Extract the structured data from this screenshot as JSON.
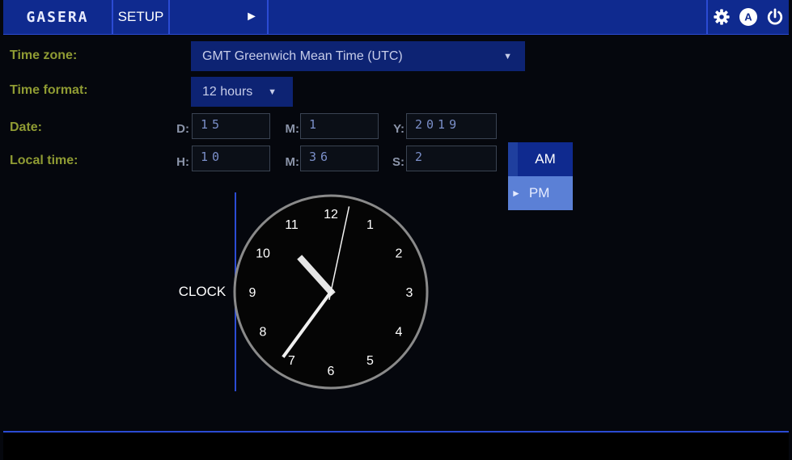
{
  "nav": {
    "brand": "GASERA",
    "tabs": [
      "SETUP",
      "CLOCK"
    ],
    "play_symbol": "►",
    "icons": [
      "gear-icon",
      "auto-mode-icon",
      "power-icon"
    ],
    "auto_letter": "A"
  },
  "settings": {
    "time_zone": {
      "label": "Time zone:",
      "value": "GMT Greenwich Mean Time (UTC)"
    },
    "time_format": {
      "label": "Time format:",
      "value": "12 hours"
    },
    "date": {
      "label": "Date:",
      "fields": [
        {
          "label": "D:",
          "value": "15"
        },
        {
          "label": "M:",
          "value": "1"
        },
        {
          "label": "Y:",
          "value": "2019"
        }
      ]
    },
    "local_time": {
      "label": "Local time:",
      "fields": [
        {
          "label": "H:",
          "value": "10"
        },
        {
          "label": "M:",
          "value": "36"
        },
        {
          "label": "S:",
          "value": "2"
        }
      ]
    }
  },
  "period": {
    "options": [
      "AM",
      "PM"
    ],
    "selected": "PM",
    "selected_marker": "►"
  },
  "clock": {
    "numbers": [
      "12",
      "1",
      "2",
      "3",
      "4",
      "5",
      "6",
      "7",
      "8",
      "9",
      "10",
      "11"
    ],
    "hour": 10,
    "minute": 36,
    "second": 2
  },
  "colors": {
    "nav_bg": "#0f2a8f",
    "label_olive": "#8f9b33",
    "field_text": "#7b8fc9"
  }
}
